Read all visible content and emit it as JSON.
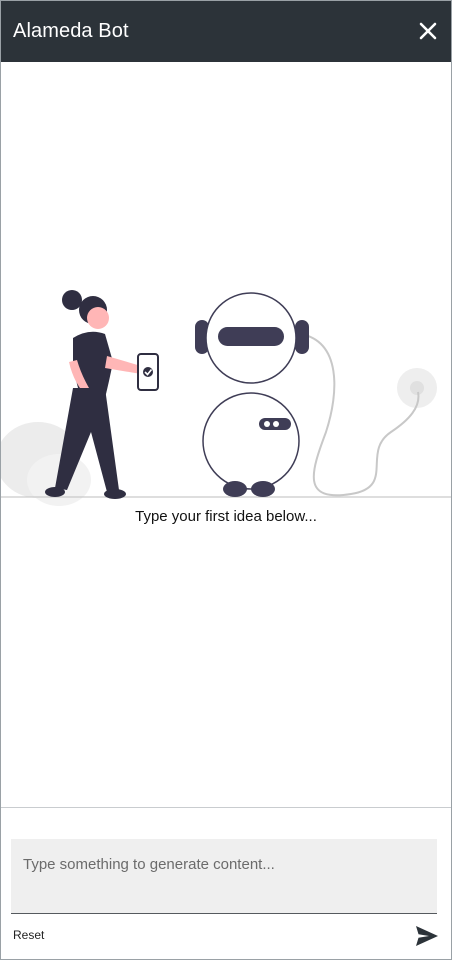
{
  "header": {
    "title": "Alameda Bot"
  },
  "chat": {
    "prompt": "Type your first idea below..."
  },
  "composer": {
    "placeholder": "Type something to generate content...",
    "value": "",
    "reset_label": "Reset"
  },
  "icons": {
    "close": "close-icon",
    "send": "send-icon"
  },
  "colors": {
    "header_bg": "#2c3339",
    "header_text": "#ffffff",
    "input_bg": "#efefef",
    "illustration_dark": "#3f3d56",
    "illustration_skin": "#ffb6b6"
  }
}
